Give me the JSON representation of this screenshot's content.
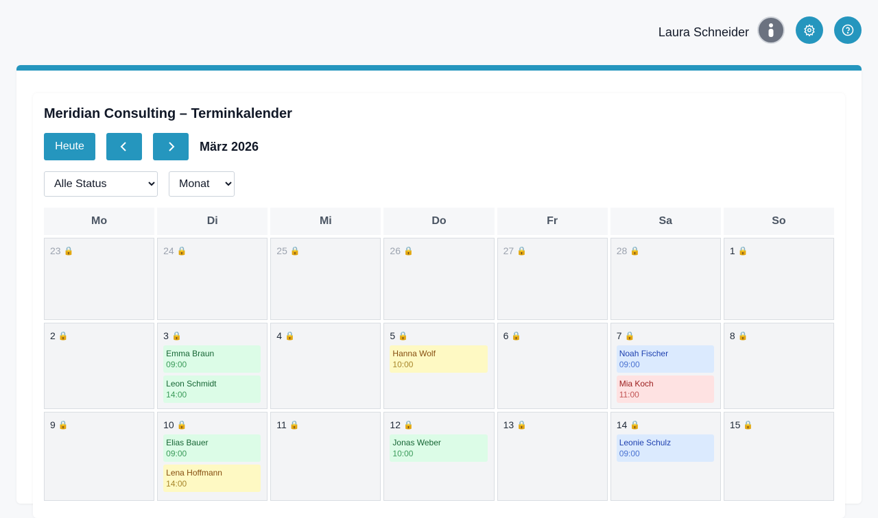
{
  "header": {
    "user_name": "Laura Schneider",
    "avatar_icon": "user-info-icon",
    "settings_icon": "gear-icon",
    "help_icon": "help-circle-icon",
    "accent_color": "#2596be"
  },
  "calendar": {
    "title": "Meridian Consulting – Terminkalender",
    "today_label": "Heute",
    "prev_icon": "chevron-left-icon",
    "next_icon": "chevron-right-icon",
    "month_label": "März 2026",
    "status_filter": {
      "selected": "Alle Status",
      "options": [
        "Alle Status"
      ]
    },
    "view_select": {
      "selected": "Monat",
      "options": [
        "Monat"
      ]
    },
    "weekdays": [
      "Mo",
      "Di",
      "Mi",
      "Do",
      "Fr",
      "Sa",
      "So"
    ],
    "lock_icon": "lock-icon",
    "weeks": [
      [
        {
          "day": "23",
          "muted": true,
          "events": []
        },
        {
          "day": "24",
          "muted": true,
          "events": []
        },
        {
          "day": "25",
          "muted": true,
          "events": []
        },
        {
          "day": "26",
          "muted": true,
          "events": []
        },
        {
          "day": "27",
          "muted": true,
          "events": []
        },
        {
          "day": "28",
          "muted": true,
          "events": []
        },
        {
          "day": "1",
          "muted": false,
          "events": []
        }
      ],
      [
        {
          "day": "2",
          "muted": false,
          "events": []
        },
        {
          "day": "3",
          "muted": false,
          "events": [
            {
              "name": "Emma Braun",
              "time": "09:00",
              "color": "green"
            },
            {
              "name": "Leon Schmidt",
              "time": "14:00",
              "color": "green"
            }
          ]
        },
        {
          "day": "4",
          "muted": false,
          "events": []
        },
        {
          "day": "5",
          "muted": false,
          "events": [
            {
              "name": "Hanna Wolf",
              "time": "10:00",
              "color": "yellow"
            }
          ]
        },
        {
          "day": "6",
          "muted": false,
          "events": []
        },
        {
          "day": "7",
          "muted": false,
          "events": [
            {
              "name": "Noah Fischer",
              "time": "09:00",
              "color": "blue"
            },
            {
              "name": "Mia Koch",
              "time": "11:00",
              "color": "red"
            }
          ]
        },
        {
          "day": "8",
          "muted": false,
          "events": []
        }
      ],
      [
        {
          "day": "9",
          "muted": false,
          "events": []
        },
        {
          "day": "10",
          "muted": false,
          "events": [
            {
              "name": "Elias Bauer",
              "time": "09:00",
              "color": "green"
            },
            {
              "name": "Lena Hoffmann",
              "time": "14:00",
              "color": "yellow"
            }
          ]
        },
        {
          "day": "11",
          "muted": false,
          "events": []
        },
        {
          "day": "12",
          "muted": false,
          "events": [
            {
              "name": "Jonas Weber",
              "time": "10:00",
              "color": "green"
            }
          ]
        },
        {
          "day": "13",
          "muted": false,
          "events": []
        },
        {
          "day": "14",
          "muted": false,
          "events": [
            {
              "name": "Leonie Schulz",
              "time": "09:00",
              "color": "blue"
            }
          ]
        },
        {
          "day": "15",
          "muted": false,
          "events": []
        }
      ]
    ]
  }
}
